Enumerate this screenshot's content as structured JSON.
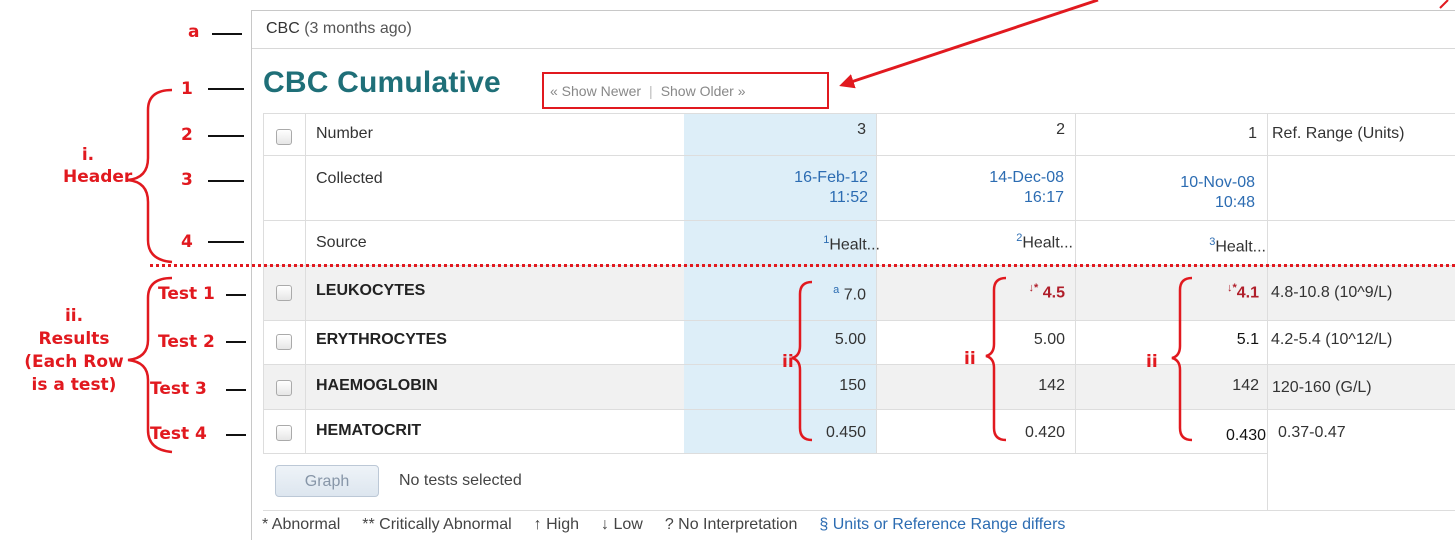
{
  "header": {
    "title_bold": "CBC",
    "title_suffix": " (3 months ago)"
  },
  "cumulative": {
    "title": "CBC Cumulative",
    "show_newer": "« Show Newer",
    "show_older": "Show Older »"
  },
  "table": {
    "row_labels": {
      "number": "Number",
      "collected": "Collected",
      "source": "Source"
    },
    "ref_header": "Ref. Range (Units)",
    "columns": [
      {
        "number": "3",
        "date": "16-Feb-12",
        "time": "11:52",
        "source_sup": "1",
        "source": "Healt..."
      },
      {
        "number": "2",
        "date": "14-Dec-08",
        "time": "16:17",
        "source_sup": "2",
        "source": "Healt..."
      },
      {
        "number": "1",
        "date": "10-Nov-08",
        "time": "10:48",
        "source_sup": "3",
        "source": "Healt..."
      }
    ],
    "tests": [
      {
        "name": "LEUKOCYTES",
        "c3_flag": "a",
        "c3": "7.0",
        "c2_flag": "↓*",
        "c2": "4.5",
        "c1_flag": "↓*",
        "c1": "4.1",
        "ref": "4.8-10.8 (10^9/L)"
      },
      {
        "name": "ERYTHROCYTES",
        "c3": "5.00",
        "c2": "5.00",
        "c1": "5.1",
        "ref": "4.2-5.4 (10^12/L)"
      },
      {
        "name": "HAEMOGLOBIN",
        "c3": "150",
        "c2": "142",
        "c1": "142",
        "ref": "120-160 (G/L)"
      },
      {
        "name": "HEMATOCRIT",
        "c3": "0.450",
        "c2": "0.420",
        "c1": "0.430",
        "ref": "0.37-0.47"
      }
    ]
  },
  "footer": {
    "graph_button": "Graph",
    "status": "No tests selected"
  },
  "legend": {
    "abnormal": "* Abnormal",
    "critical": "** Critically Abnormal",
    "high": "↑ High",
    "low": "↓ Low",
    "no_interp": "? No Interpretation",
    "units": "§ Units or Reference Range differs"
  },
  "annotations": {
    "a": "a",
    "n1": "1",
    "n2": "2",
    "n3": "3",
    "n4": "4",
    "header_i": "i.",
    "header_word": "Header",
    "results_ii": "ii.",
    "results_l1": "Results",
    "results_l2": "(Each Row",
    "results_l3": "is a test)",
    "test1": "Test 1",
    "test2": "Test 2",
    "test3": "Test 3",
    "test4": "Test 4",
    "brace_ii": "ii",
    "accent": "#e1191f"
  }
}
